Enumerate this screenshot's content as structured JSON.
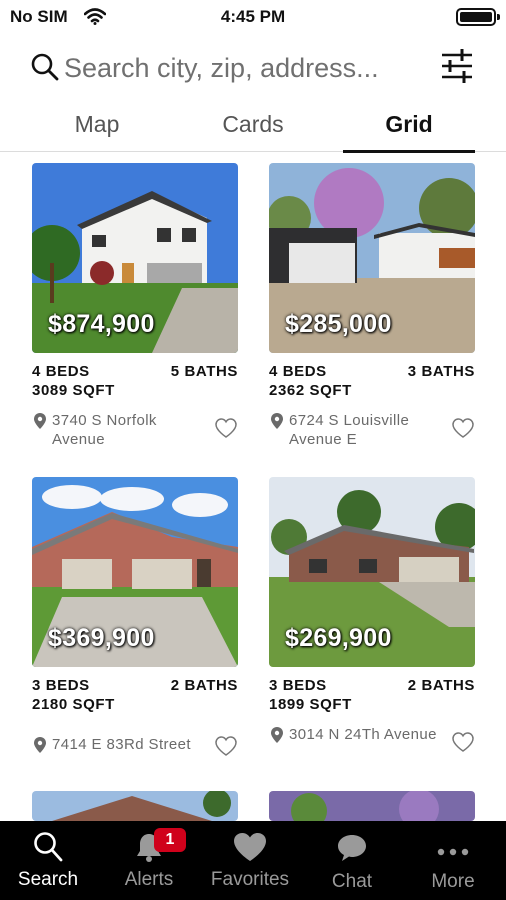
{
  "status_bar": {
    "carrier": "No SIM",
    "time": "4:45 PM"
  },
  "search": {
    "placeholder": "Search city, zip, address..."
  },
  "tabs": [
    {
      "label": "Map"
    },
    {
      "label": "Cards"
    },
    {
      "label": "Grid",
      "active": true
    }
  ],
  "listings": [
    {
      "price": "$874,900",
      "beds": "4 BEDS",
      "baths": "5 BATHS",
      "sqft": "3089 SQFT",
      "address": "3740 S Norfolk Avenue"
    },
    {
      "price": "$285,000",
      "beds": "4 BEDS",
      "baths": "3 BATHS",
      "sqft": "2362 SQFT",
      "address": "6724 S Louisville Avenue E"
    },
    {
      "price": "$369,900",
      "beds": "3 BEDS",
      "baths": "2 BATHS",
      "sqft": "2180 SQFT",
      "address": "7414 E 83Rd Street"
    },
    {
      "price": "$269,900",
      "beds": "3 BEDS",
      "baths": "2 BATHS",
      "sqft": "1899 SQFT",
      "address": "3014 N 24Th Avenue"
    }
  ],
  "bottom_nav": {
    "search": "Search",
    "alerts": "Alerts",
    "alerts_badge": "1",
    "favorites": "Favorites",
    "chat": "Chat",
    "more": "More"
  },
  "colors": {
    "badge": "#d0011b",
    "nav_bg": "#000000",
    "active_tab": "#111111"
  }
}
